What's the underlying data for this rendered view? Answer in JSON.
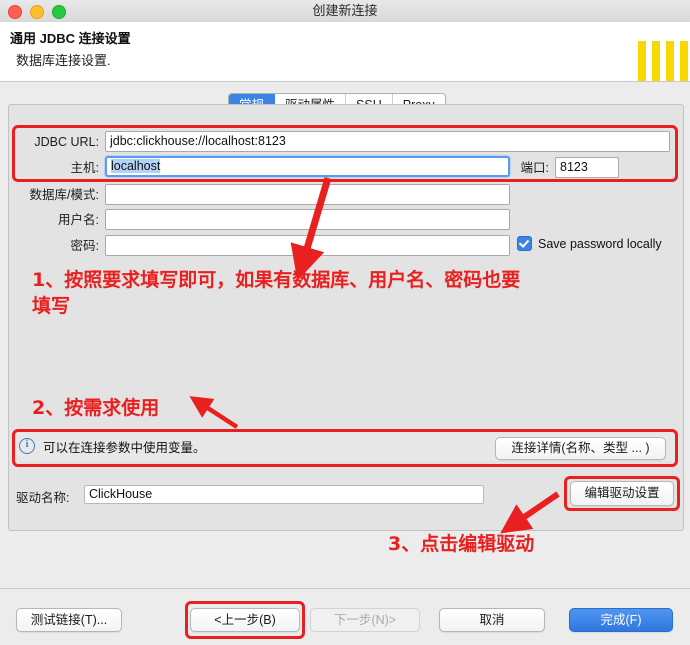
{
  "window": {
    "title": "创建新连接",
    "traffic_lights": [
      "close",
      "minimize",
      "zoom"
    ]
  },
  "header": {
    "title": "通用 JDBC 连接设置",
    "subtitle": "数据库连接设置.",
    "logo_name": "dbeaver-logo"
  },
  "tabs": [
    {
      "label": "常规",
      "active": true
    },
    {
      "label": "驱动属性",
      "active": false
    },
    {
      "label": "SSH",
      "active": false
    },
    {
      "label": "Proxy",
      "active": false
    }
  ],
  "form": {
    "jdbc_url": {
      "label": "JDBC URL:",
      "value": "jdbc:clickhouse://localhost:8123"
    },
    "host": {
      "label": "主机:",
      "value": "localhost",
      "selected": true
    },
    "port": {
      "label": "端口:",
      "value": "8123"
    },
    "database": {
      "label": "数据库/模式:",
      "value": ""
    },
    "username": {
      "label": "用户名:",
      "value": ""
    },
    "password": {
      "label": "密码:",
      "value": ""
    },
    "save_password": {
      "label": "Save password locally",
      "checked": true
    }
  },
  "info_bar": {
    "icon": "info-icon",
    "text": "可以在连接参数中使用变量。",
    "button_label": "连接详情(名称、类型 ... )"
  },
  "driver": {
    "label": "驱动名称:",
    "value": "ClickHouse",
    "edit_button_label": "编辑驱动设置"
  },
  "footer": {
    "test": "测试链接(T)...",
    "previous": "<上一步(B)",
    "next": "下一步(N)>",
    "cancel": "取消",
    "finish": "完成(F)"
  },
  "annotations": {
    "accent_color": "#e8201f",
    "note1": "1、按照要求填写即可，如果有数据库、用户名、密码也要\n填写",
    "note2": "2、按需求使用",
    "note3": "3、点击编辑驱动"
  }
}
